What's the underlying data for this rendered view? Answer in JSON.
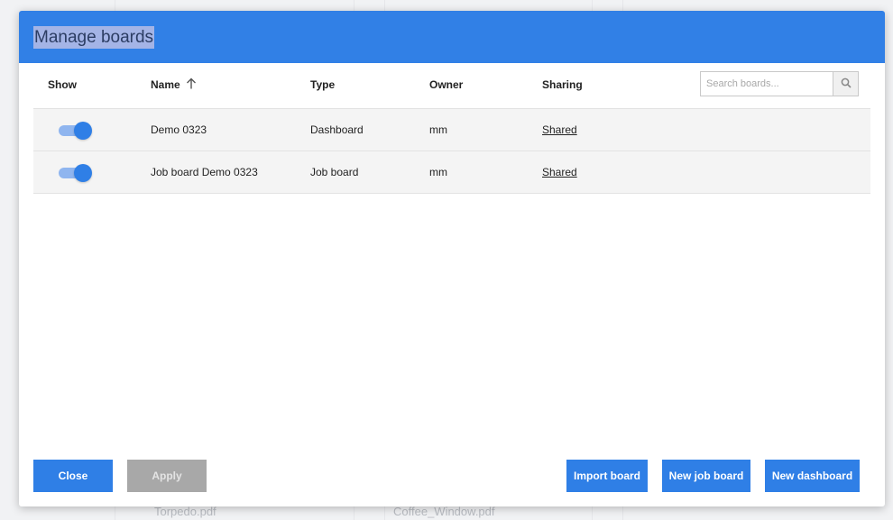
{
  "background": {
    "files": [
      "Torpedo.pdf",
      "Coffee_Window.pdf"
    ]
  },
  "dialog": {
    "title": "Manage boards",
    "columns": {
      "show": "Show",
      "name": "Name",
      "type": "Type",
      "owner": "Owner",
      "sharing": "Sharing"
    },
    "sort_icon": "arrow-up-icon",
    "search": {
      "placeholder": "Search boards...",
      "value": "",
      "icon": "search-icon"
    },
    "rows": [
      {
        "show": true,
        "name": "Demo 0323",
        "type": "Dashboard",
        "owner": "mm",
        "sharing": "Shared"
      },
      {
        "show": true,
        "name": "Job board Demo 0323",
        "type": "Job board",
        "owner": "mm",
        "sharing": "Shared"
      }
    ],
    "buttons": {
      "close": "Close",
      "apply": "Apply",
      "import": "Import board",
      "new_job_board": "New job board",
      "new_dashboard": "New dashboard"
    }
  },
  "colors": {
    "accent": "#2f7fe6",
    "header": "#3180e6",
    "disabled": "#a8a8a8",
    "row_bg": "#f4f4f4"
  }
}
